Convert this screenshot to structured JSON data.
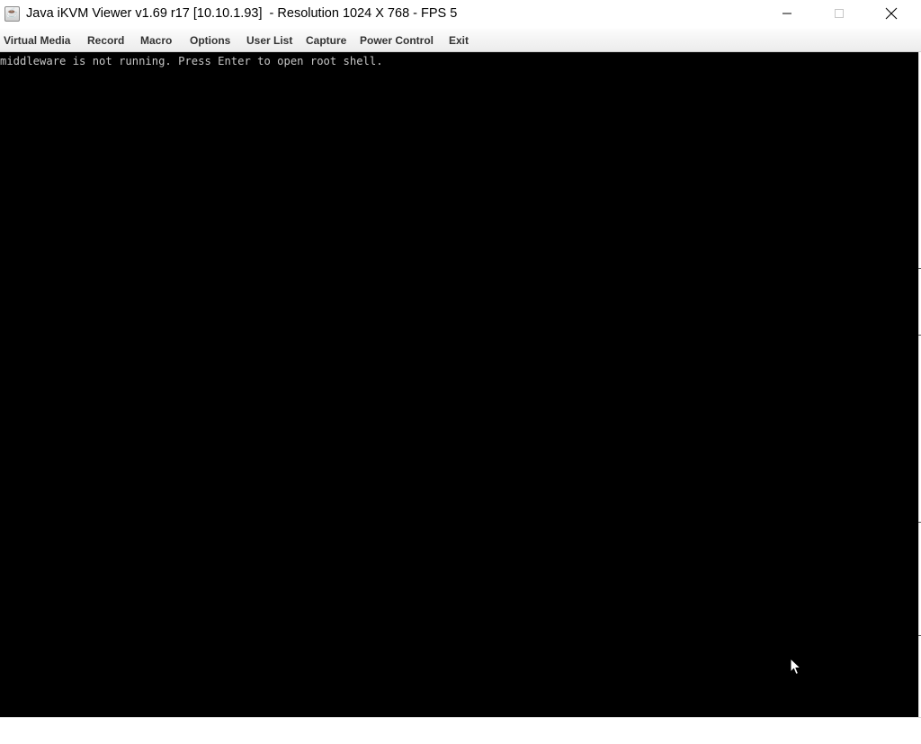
{
  "window": {
    "title": "Java iKVM Viewer v1.69 r17 [10.10.1.93]  - Resolution 1024 X 768 - FPS 5",
    "app_icon": "java-cup-icon",
    "controls": [
      "minimize-icon",
      "maximize-icon",
      "close-icon"
    ]
  },
  "menubar": {
    "items": [
      {
        "label": "Virtual Media"
      },
      {
        "label": "Record"
      },
      {
        "label": "Macro"
      },
      {
        "label": "Options"
      },
      {
        "label": "User List"
      },
      {
        "label": "Capture"
      },
      {
        "label": "Power Control"
      },
      {
        "label": "Exit"
      }
    ]
  },
  "console": {
    "lines": [
      "middleware is not running. Press Enter to open root shell."
    ],
    "background": "#000000",
    "text_color": "#c6c6c6"
  },
  "pointer": {
    "icon": "mouse-pointer-icon"
  }
}
